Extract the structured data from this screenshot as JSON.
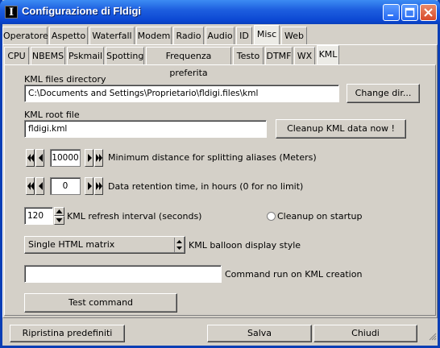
{
  "window": {
    "title": "Configurazione di Fldigi",
    "app_icon_glyph": "I"
  },
  "main_tabs": [
    "Operatore",
    "Aspetto",
    "Waterfall",
    "Modem",
    "Radio",
    "Audio",
    "ID",
    "Misc",
    "Web"
  ],
  "main_tab_selected": "Misc",
  "sub_tabs": [
    "CPU",
    "NBEMS",
    "Pskmail",
    "Spotting",
    "Frequenza preferita",
    "Testo",
    "DTMF",
    "WX",
    "KML"
  ],
  "sub_tab_selected": "KML",
  "kml": {
    "dir_label": "KML files directory",
    "dir_value": "C:\\Documents and Settings\\Proprietario\\fldigi.files\\kml",
    "change_dir_button": "Change dir...",
    "root_label": "KML root file",
    "root_value": "fldigi.kml",
    "cleanup_button": "Cleanup KML data now !",
    "min_distance_value": "10000",
    "min_distance_label": "Minimum distance for splitting aliases (Meters)",
    "retention_value": "0",
    "retention_label": "Data retention time, in hours (0 for no limit)",
    "refresh_value": "120",
    "refresh_label": "KML refresh interval (seconds)",
    "cleanup_startup_label": "Cleanup on startup",
    "balloon_value": "Single HTML matrix",
    "balloon_label": "KML balloon display style",
    "command_value": "",
    "command_label": "Command run on KML creation",
    "test_button": "Test command"
  },
  "footer": {
    "restore_button": "Ripristina predefiniti",
    "save_button": "Salva",
    "close_button": "Chiudi"
  }
}
